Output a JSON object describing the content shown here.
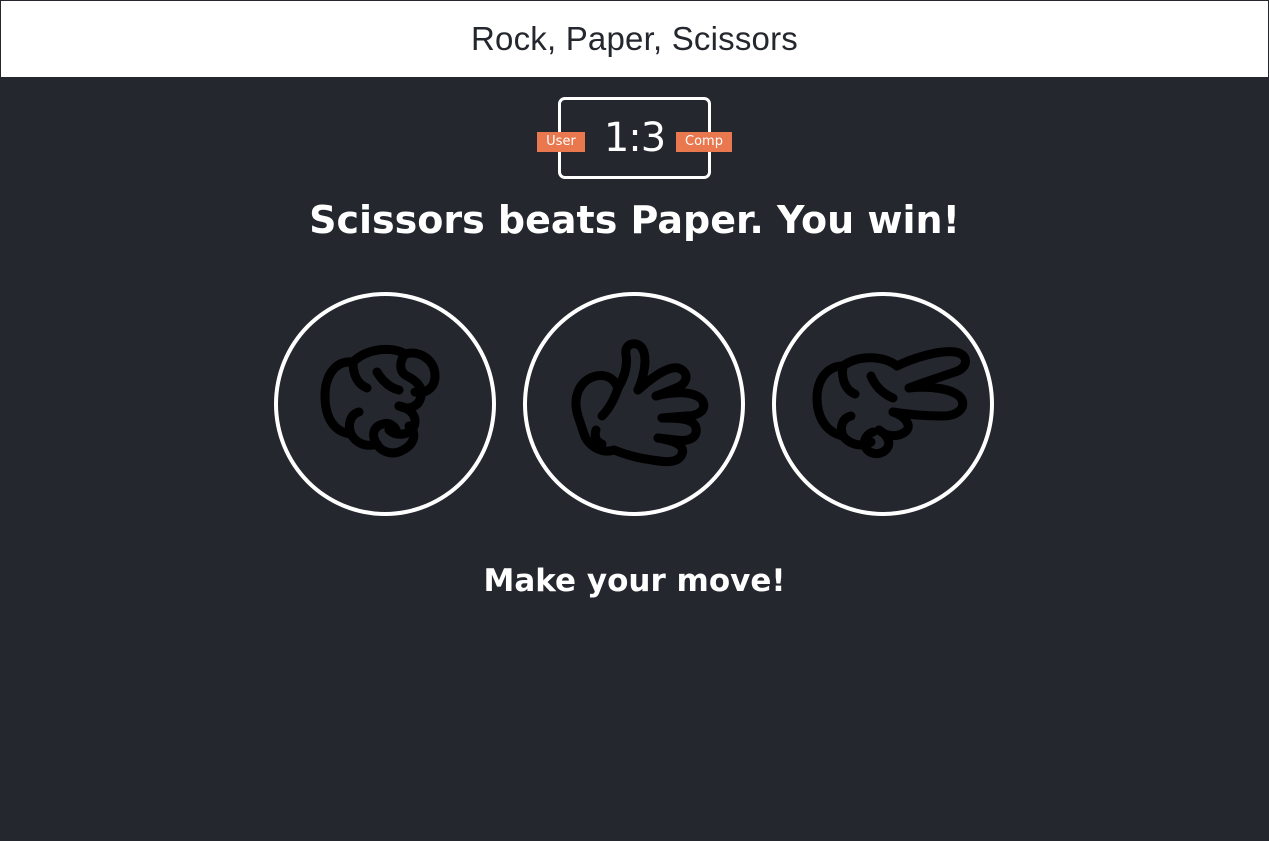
{
  "header": {
    "title": "Rock, Paper, Scissors"
  },
  "scoreboard": {
    "user_label": "User",
    "comp_label": "Comp",
    "score": "1:3",
    "user_score": 1,
    "comp_score": 3,
    "badge_color": "#e9784e"
  },
  "result": {
    "message": "Scissors beats Paper. You win!"
  },
  "choices": [
    {
      "id": "rock",
      "icon": "rock-hand-icon"
    },
    {
      "id": "paper",
      "icon": "paper-hand-icon"
    },
    {
      "id": "scissors",
      "icon": "scissors-hand-icon"
    }
  ],
  "prompt": {
    "text": "Make your move!"
  },
  "colors": {
    "background": "#24272e",
    "header_background": "#ffffff",
    "text": "#ffffff",
    "accent": "#e9784e"
  }
}
